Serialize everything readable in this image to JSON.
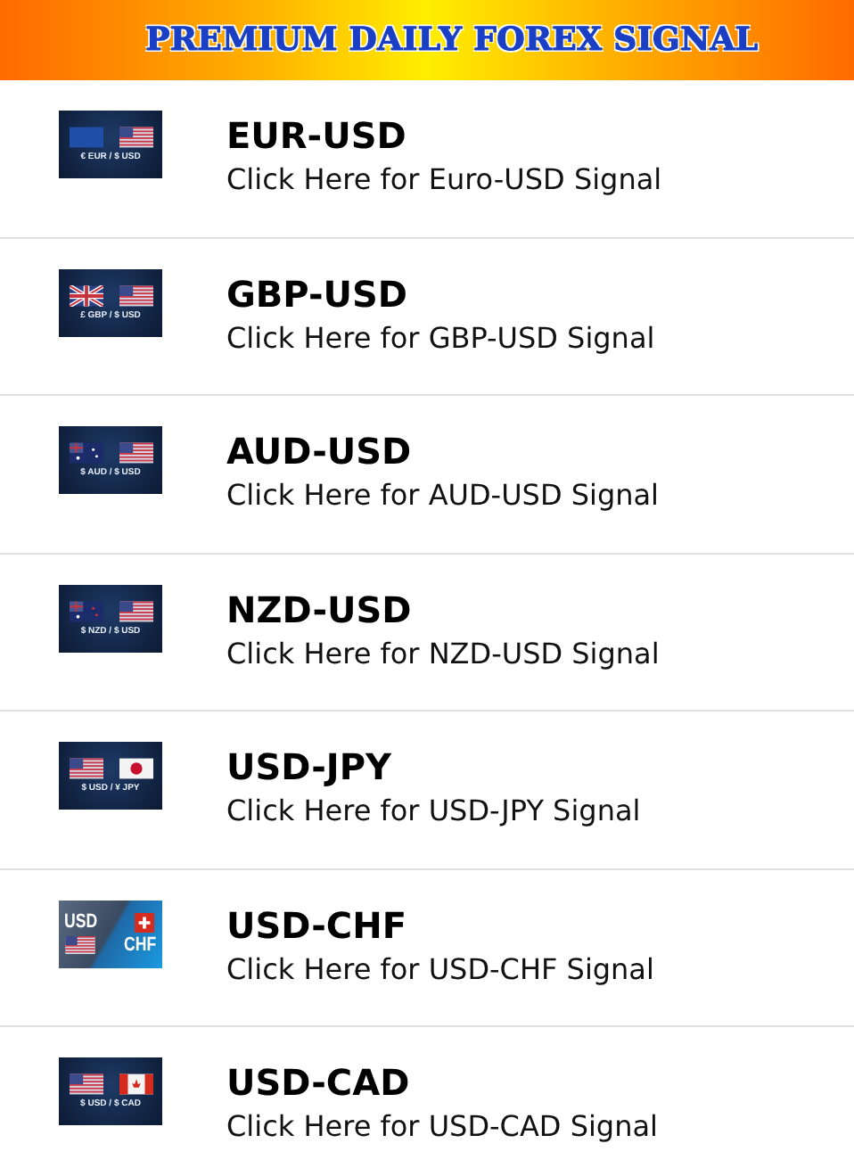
{
  "header": {
    "title": "PREMIUM DAILY FOREX SIGNAL"
  },
  "signals": [
    {
      "pair": "EUR-USD",
      "link": "Click Here for Euro-USD Signal",
      "thumbnail": {
        "kind": "banner",
        "flags": [
          {
            "kind": "eu"
          },
          {
            "kind": "us"
          }
        ],
        "caption": "€ EUR / $ USD"
      }
    },
    {
      "pair": "GBP-USD",
      "link": "Click Here for GBP-USD Signal",
      "thumbnail": {
        "kind": "banner",
        "flags": [
          {
            "kind": "gb"
          },
          {
            "kind": "us"
          }
        ],
        "caption": "£ GBP / $ USD"
      }
    },
    {
      "pair": "AUD-USD",
      "link": "Click Here for AUD-USD Signal",
      "thumbnail": {
        "kind": "banner",
        "flags": [
          {
            "kind": "au"
          },
          {
            "kind": "us"
          }
        ],
        "caption": "$ AUD / $ USD"
      }
    },
    {
      "pair": "NZD-USD",
      "link": "Click Here for NZD-USD Signal",
      "thumbnail": {
        "kind": "banner",
        "flags": [
          {
            "kind": "nz"
          },
          {
            "kind": "us"
          }
        ],
        "caption": "$ NZD / $ USD"
      }
    },
    {
      "pair": "USD-JPY",
      "link": "Click Here for USD-JPY Signal",
      "thumbnail": {
        "kind": "banner",
        "flags": [
          {
            "kind": "us"
          },
          {
            "kind": "jp"
          }
        ],
        "caption": "$ USD / ¥ JPY"
      }
    },
    {
      "pair": "USD-CHF",
      "link": "Click Here for USD-CHF Signal",
      "thumbnail": {
        "kind": "split",
        "flags": [
          {
            "kind": "us"
          },
          {
            "kind": "ch"
          }
        ],
        "labels": [
          "USD",
          "CHF"
        ]
      }
    },
    {
      "pair": "USD-CAD",
      "link": "Click Here for USD-CAD Signal",
      "thumbnail": {
        "kind": "banner",
        "flags": [
          {
            "kind": "us"
          },
          {
            "kind": "ca"
          }
        ],
        "caption": "$ USD / $ CAD"
      }
    }
  ]
}
